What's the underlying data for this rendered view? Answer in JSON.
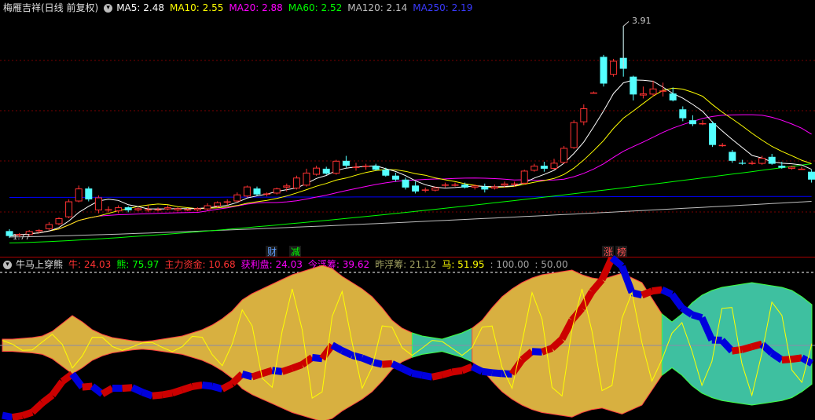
{
  "colors": {
    "up": "#ff3232",
    "down": "#54ffff",
    "ma5": "#ffffff",
    "ma10": "#ffff00",
    "ma20": "#ff00ff",
    "ma60": "#00ff00",
    "ma120": "#bfbfbf",
    "ma250": "#0000ff",
    "grid": "#7a0000",
    "bull": "#d8b040",
    "bear": "#3ec0a0",
    "red": "#cc0000",
    "blue": "#0000dd",
    "yellow": "#ffff00"
  },
  "main": {
    "title": "梅雁吉祥(日线 前复权)",
    "ma": [
      {
        "label": "MA5: 2.48",
        "color": "#ffffff"
      },
      {
        "label": "MA10: 2.55",
        "color": "#ffff00"
      },
      {
        "label": "MA20: 2.88",
        "color": "#ff00ff"
      },
      {
        "label": "MA60: 2.52",
        "color": "#00ff00"
      },
      {
        "label": "MA120: 2.14",
        "color": "#bfbfbf"
      },
      {
        "label": "MA250: 2.19",
        "color": "#0000ff"
      }
    ],
    "peak_label": "3.91",
    "low_label": "1.77",
    "badges": [
      {
        "text": "财",
        "color": "#5f9fff"
      },
      {
        "text": "减",
        "color": "#00ff00"
      },
      {
        "text": "涨",
        "color": "#ff5050"
      },
      {
        "text": "榜",
        "color": "#ff5050"
      }
    ]
  },
  "sub": {
    "title": "牛马上穿熊",
    "items": [
      {
        "label": "牛: 24.03",
        "color": "#ff3232"
      },
      {
        "label": "熊: 75.97",
        "color": "#00ff00"
      },
      {
        "label": "主力资金: 10.68",
        "color": "#ff3232"
      },
      {
        "label": "获利盘: 24.03",
        "color": "#ff00ff"
      },
      {
        "label": "今浮筹: 39.62",
        "color": "#ff00ff"
      },
      {
        "label": "昨浮筹: 21.12",
        "color": "#a0a060"
      },
      {
        "label": "马: 51.95",
        "color": "#ffff00"
      },
      {
        "label": ": 100.00",
        "color": "#a0a0a0"
      },
      {
        "label": ": 50.00",
        "color": "#a0a0a0"
      }
    ]
  },
  "chart_data": {
    "type": "candlestick",
    "ylim": [
      1.7,
      4.0
    ],
    "candles": [
      [
        1.84,
        1.86,
        1.77,
        1.79
      ],
      [
        1.8,
        1.82,
        1.78,
        1.81
      ],
      [
        1.8,
        1.85,
        1.79,
        1.84
      ],
      [
        1.84,
        1.86,
        1.82,
        1.85
      ],
      [
        1.86,
        1.93,
        1.85,
        1.91
      ],
      [
        1.91,
        1.98,
        1.9,
        1.97
      ],
      [
        1.98,
        2.16,
        1.97,
        2.14
      ],
      [
        2.14,
        2.3,
        2.13,
        2.27
      ],
      [
        2.27,
        2.29,
        2.14,
        2.16
      ],
      [
        2.05,
        2.2,
        2.02,
        2.18
      ],
      [
        2.05,
        2.09,
        2.03,
        2.06
      ],
      [
        2.04,
        2.1,
        2.02,
        2.08
      ],
      [
        2.08,
        2.09,
        2.03,
        2.05
      ],
      [
        2.05,
        2.08,
        2.04,
        2.07
      ],
      [
        2.05,
        2.1,
        2.03,
        2.06
      ],
      [
        2.05,
        2.08,
        2.04,
        2.06
      ],
      [
        2.06,
        2.1,
        2.05,
        2.08
      ],
      [
        2.05,
        2.08,
        2.04,
        2.07
      ],
      [
        2.05,
        2.07,
        2.04,
        2.06
      ],
      [
        2.05,
        2.08,
        2.04,
        2.07
      ],
      [
        2.06,
        2.12,
        2.05,
        2.1
      ],
      [
        2.09,
        2.14,
        2.08,
        2.13
      ],
      [
        2.13,
        2.16,
        2.1,
        2.14
      ],
      [
        2.14,
        2.23,
        2.13,
        2.21
      ],
      [
        2.19,
        2.3,
        2.18,
        2.29
      ],
      [
        2.27,
        2.29,
        2.2,
        2.21
      ],
      [
        2.21,
        2.23,
        2.19,
        2.22
      ],
      [
        2.22,
        2.28,
        2.21,
        2.27
      ],
      [
        2.28,
        2.32,
        2.24,
        2.3
      ],
      [
        2.27,
        2.4,
        2.26,
        2.38
      ],
      [
        2.3,
        2.47,
        2.29,
        2.43
      ],
      [
        2.41,
        2.5,
        2.4,
        2.48
      ],
      [
        2.47,
        2.49,
        2.41,
        2.42
      ],
      [
        2.42,
        2.56,
        2.41,
        2.55
      ],
      [
        2.55,
        2.6,
        2.48,
        2.5
      ],
      [
        2.48,
        2.53,
        2.45,
        2.49
      ],
      [
        2.49,
        2.52,
        2.46,
        2.5
      ],
      [
        2.5,
        2.52,
        2.45,
        2.46
      ],
      [
        2.46,
        2.48,
        2.39,
        2.4
      ],
      [
        2.4,
        2.43,
        2.34,
        2.36
      ],
      [
        2.36,
        2.38,
        2.26,
        2.28
      ],
      [
        2.3,
        2.34,
        2.22,
        2.24
      ],
      [
        2.25,
        2.28,
        2.23,
        2.26
      ],
      [
        2.25,
        2.29,
        2.24,
        2.28
      ],
      [
        2.3,
        2.33,
        2.28,
        2.31
      ],
      [
        2.31,
        2.33,
        2.29,
        2.31
      ],
      [
        2.31,
        2.33,
        2.27,
        2.28
      ],
      [
        2.28,
        2.31,
        2.26,
        2.3
      ],
      [
        2.29,
        2.32,
        2.23,
        2.26
      ],
      [
        2.27,
        2.31,
        2.26,
        2.29
      ],
      [
        2.3,
        2.34,
        2.28,
        2.32
      ],
      [
        2.31,
        2.34,
        2.29,
        2.32
      ],
      [
        2.32,
        2.46,
        2.31,
        2.45
      ],
      [
        2.45,
        2.52,
        2.44,
        2.5
      ],
      [
        2.5,
        2.54,
        2.44,
        2.47
      ],
      [
        2.47,
        2.57,
        2.46,
        2.53
      ],
      [
        2.53,
        2.7,
        2.52,
        2.68
      ],
      [
        2.68,
        2.96,
        2.67,
        2.94
      ],
      [
        2.94,
        3.12,
        2.91,
        3.08
      ],
      [
        3.24,
        3.25,
        3.24,
        3.24
      ],
      [
        3.6,
        3.62,
        3.3,
        3.33
      ],
      [
        3.42,
        3.58,
        3.4,
        3.56
      ],
      [
        3.59,
        3.91,
        3.4,
        3.48
      ],
      [
        3.4,
        3.41,
        3.16,
        3.22
      ],
      [
        3.21,
        3.3,
        3.18,
        3.23
      ],
      [
        3.22,
        3.36,
        3.2,
        3.28
      ],
      [
        3.25,
        3.34,
        3.2,
        3.26
      ],
      [
        3.23,
        3.29,
        3.15,
        3.16
      ],
      [
        3.07,
        3.1,
        2.95,
        2.98
      ],
      [
        2.96,
        3.01,
        2.9,
        2.92
      ],
      [
        2.92,
        2.96,
        2.91,
        2.93
      ],
      [
        2.93,
        2.95,
        2.69,
        2.71
      ],
      [
        2.71,
        2.73,
        2.69,
        2.71
      ],
      [
        2.64,
        2.66,
        2.53,
        2.55
      ],
      [
        2.53,
        2.56,
        2.51,
        2.52
      ],
      [
        2.52,
        2.55,
        2.51,
        2.53
      ],
      [
        2.52,
        2.6,
        2.51,
        2.58
      ],
      [
        2.59,
        2.62,
        2.51,
        2.52
      ],
      [
        2.5,
        2.54,
        2.47,
        2.48
      ],
      [
        2.47,
        2.5,
        2.46,
        2.49
      ],
      [
        2.47,
        2.49,
        2.46,
        2.47
      ],
      [
        2.44,
        2.46,
        2.33,
        2.36
      ]
    ]
  }
}
